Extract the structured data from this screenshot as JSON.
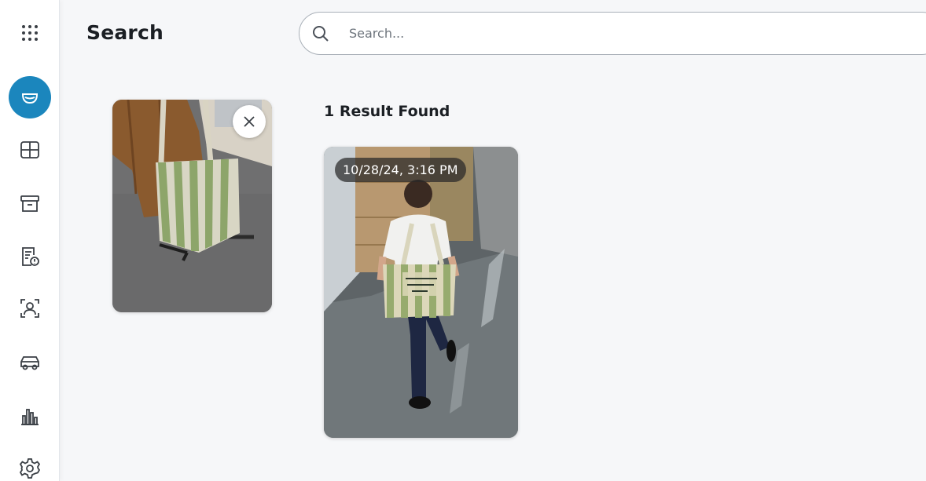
{
  "header": {
    "title": "Search",
    "search_placeholder": "Search..."
  },
  "sidebar": {
    "items": [
      {
        "icon": "apps-grid-icon"
      },
      {
        "icon": "camera-dome-icon",
        "active": true
      },
      {
        "icon": "dashboard-grid-icon"
      },
      {
        "icon": "archive-box-icon"
      },
      {
        "icon": "alert-report-icon"
      },
      {
        "icon": "person-detect-icon"
      },
      {
        "icon": "vehicle-icon"
      },
      {
        "icon": "analytics-bars-icon"
      },
      {
        "icon": "settings-gear-icon"
      }
    ]
  },
  "query": {
    "close_icon": "close-icon"
  },
  "results": {
    "count_label": "1 Result Found",
    "items": [
      {
        "timestamp": "10/28/24, 3:16 PM"
      }
    ]
  },
  "colors": {
    "accent": "#1b86bd",
    "background": "#f6f7f9",
    "sidebar": "#ffffff",
    "icon_stroke": "#3a3f45"
  }
}
